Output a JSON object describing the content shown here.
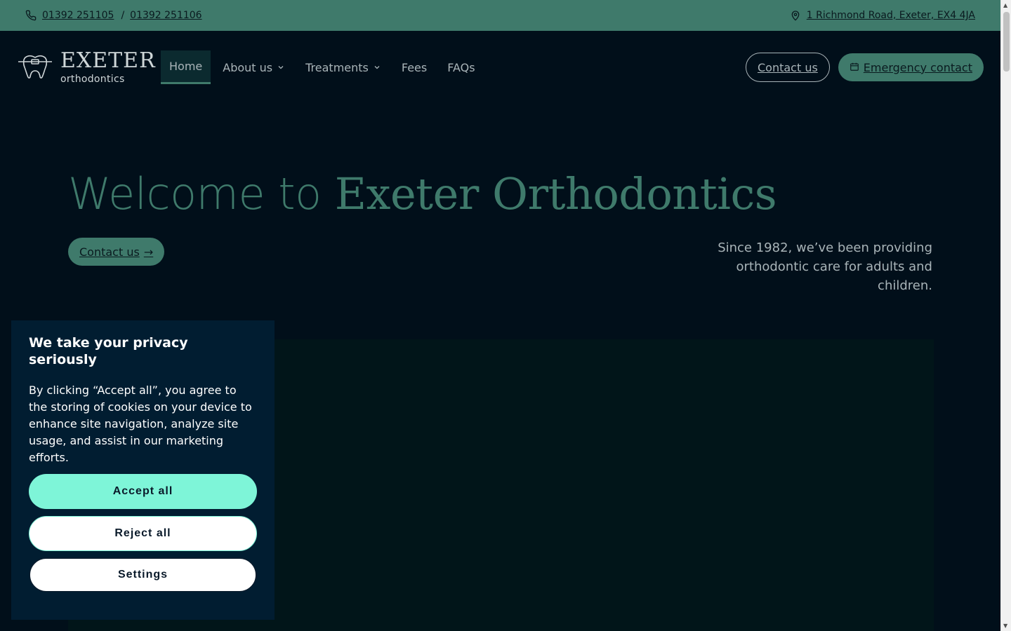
{
  "topbar": {
    "phone1": "01392 251105",
    "separator": "/",
    "phone2": "01392 251106",
    "address": "1 Richmond Road, Exeter, EX4 4JA",
    "phone_icon": "phone-icon",
    "location_icon": "map-pin-icon"
  },
  "header": {
    "logo_title": "EXETER",
    "logo_subtitle": "orthodontics",
    "nav": [
      {
        "label": "Home",
        "active": true
      },
      {
        "label": "About us",
        "dropdown": true
      },
      {
        "label": "Treatments",
        "dropdown": true
      },
      {
        "label": "Fees"
      },
      {
        "label": "FAQs"
      }
    ],
    "contact_label": "Contact us",
    "emergency_label": "Emergency contact"
  },
  "hero": {
    "title_prefix": "Welcome to ",
    "title_brand": "Exeter Orthodontics",
    "cta_label": "Contact us",
    "cta_arrow": "→",
    "description": "Since 1982, we’ve been providing orthodontic care for adults and children."
  },
  "cookie": {
    "title": "We take your privacy seriously",
    "body": "By clicking “Accept all”, you agree to the storing of cookies on your device to enhance site navigation, analyze site usage, and assist in our marketing efforts.",
    "accept": "Accept all",
    "reject": "Reject all",
    "settings": "Settings"
  },
  "colors": {
    "brand_green": "#3f7a6b",
    "background": "#010f1a",
    "accept_mint": "#7ef5d8",
    "cookie_panel": "#011d31"
  }
}
